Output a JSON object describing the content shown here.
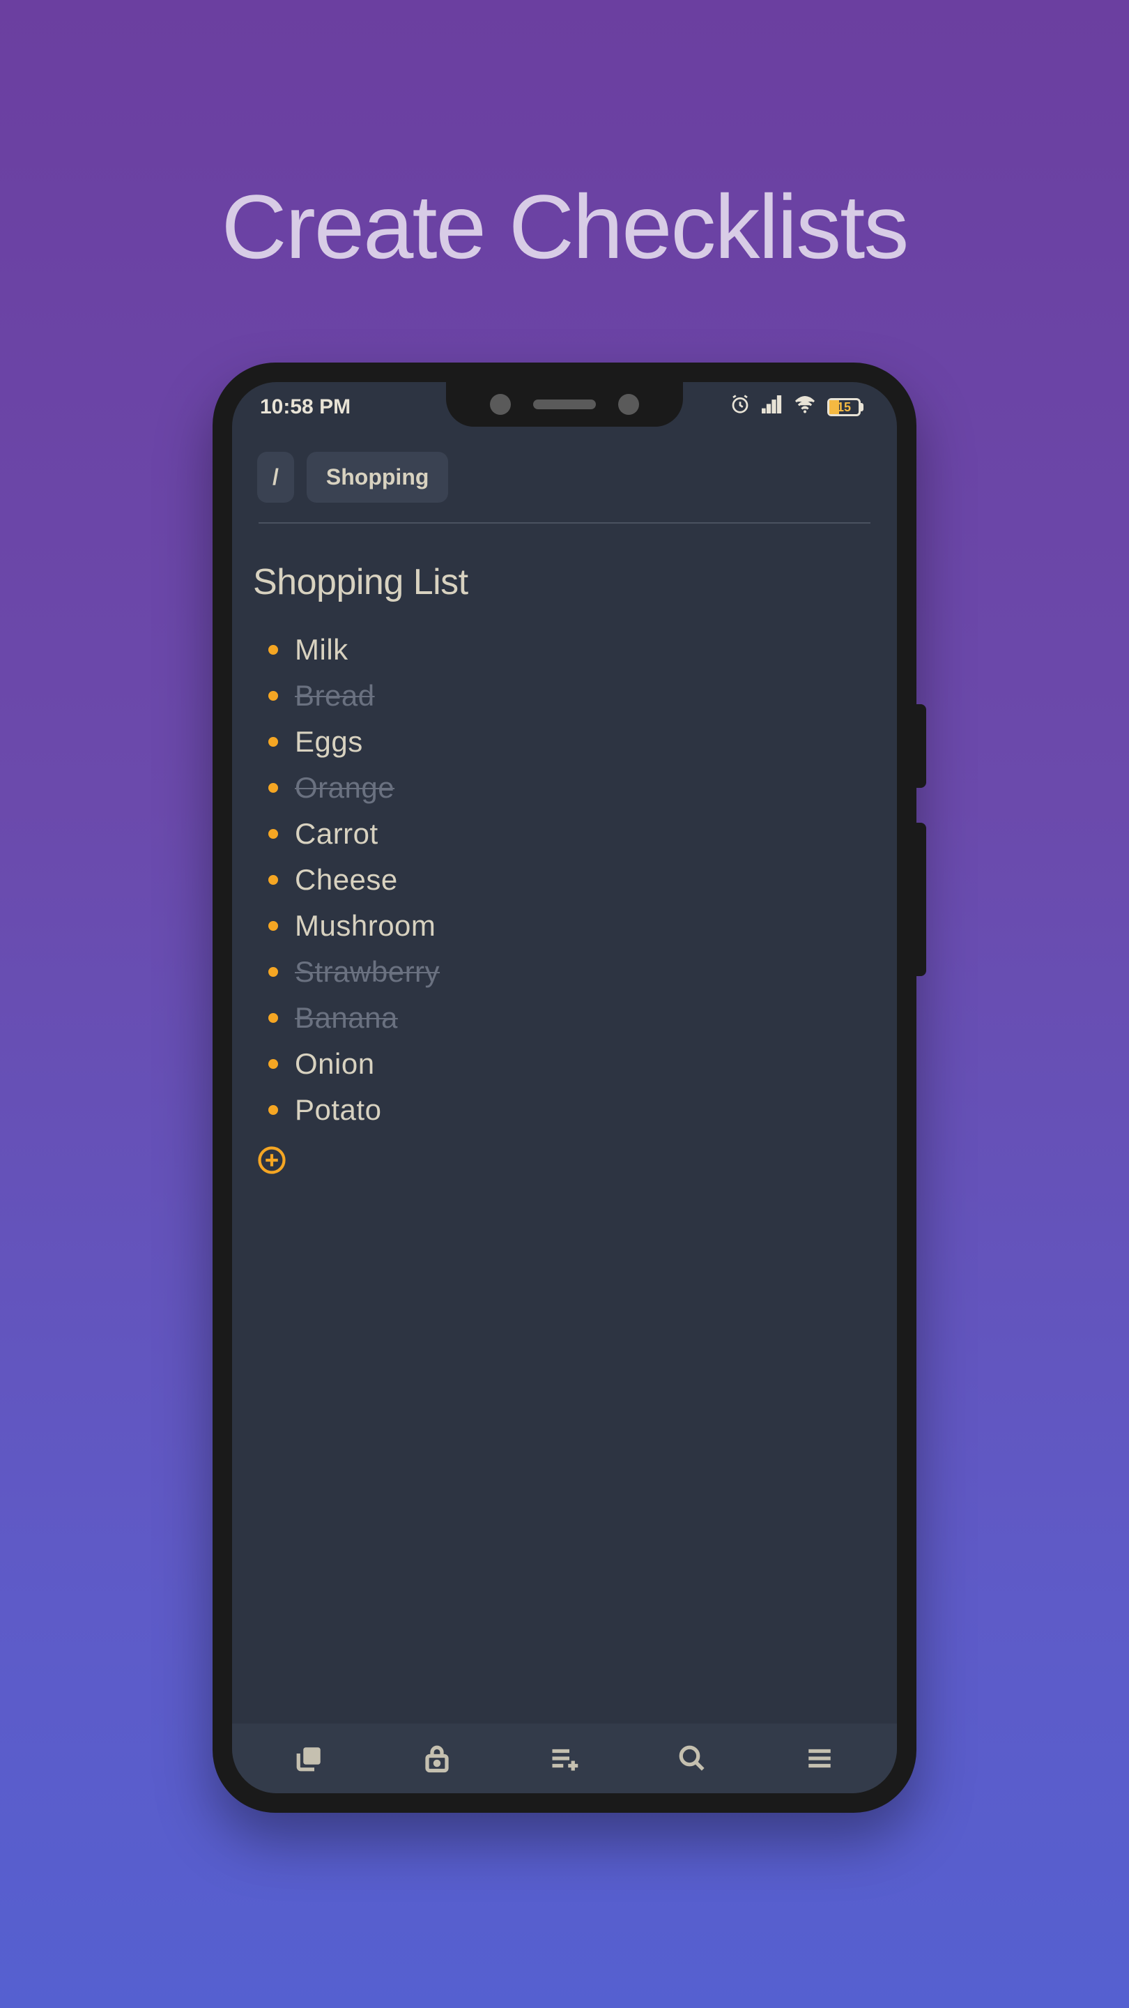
{
  "headline": "Create Checklists",
  "status": {
    "time": "10:58 PM",
    "battery_pct": "15"
  },
  "breadcrumb": {
    "root": "/",
    "folder": "Shopping"
  },
  "note": {
    "title": "Shopping List",
    "items": [
      {
        "text": "Milk",
        "done": false
      },
      {
        "text": "Bread",
        "done": true
      },
      {
        "text": "Eggs",
        "done": false
      },
      {
        "text": "Orange",
        "done": true
      },
      {
        "text": "Carrot",
        "done": false
      },
      {
        "text": "Cheese",
        "done": false
      },
      {
        "text": "Mushroom",
        "done": false
      },
      {
        "text": "Strawberry",
        "done": true
      },
      {
        "text": "Banana",
        "done": true
      },
      {
        "text": "Onion",
        "done": false
      },
      {
        "text": "Potato",
        "done": false
      }
    ]
  },
  "nav": {
    "library": "library-icon",
    "lock": "lock-icon",
    "playlist_add": "list-add-icon",
    "search": "search-icon",
    "menu": "menu-icon"
  }
}
